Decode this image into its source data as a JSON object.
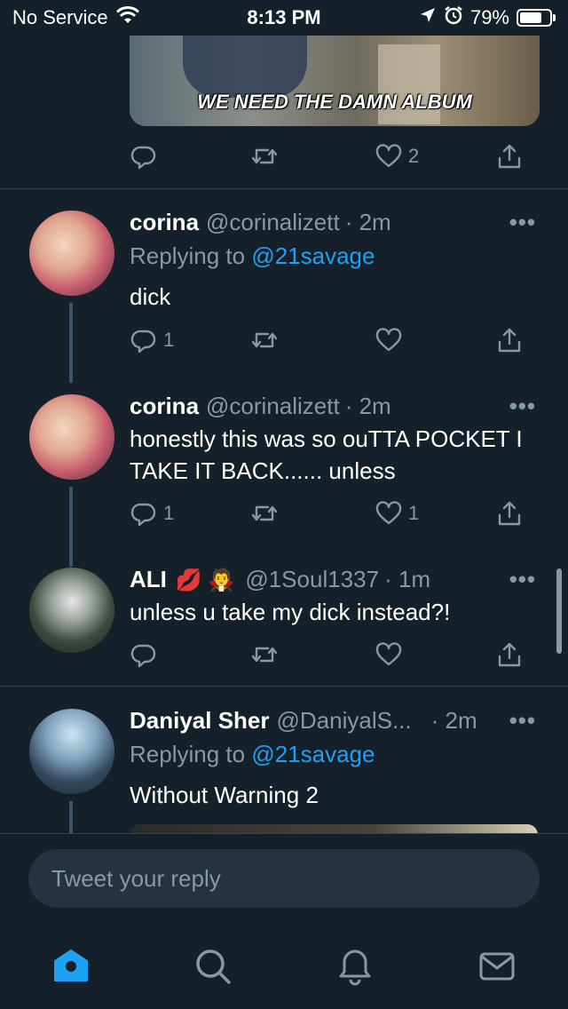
{
  "status_bar": {
    "carrier": "No Service",
    "time": "8:13 PM",
    "battery": "79%",
    "battery_level": 0.79
  },
  "top_tweet": {
    "media_caption": "WE NEED THE DAMN ALBUM",
    "reply_count": "",
    "retweet_count": "",
    "like_count": "2"
  },
  "tweets": [
    {
      "name": "corina",
      "handle": "@corinalizett",
      "time": "· 2m",
      "replying_to_prefix": "Replying to",
      "replying_to": "@21savage",
      "text": "dick",
      "reply_count": "1",
      "retweet_count": "",
      "like_count": ""
    },
    {
      "name": "corina",
      "handle": "@corinalizett",
      "time": "· 2m",
      "text": "honestly this was so ouTTA POCKET I TAKE IT BACK...... unless",
      "reply_count": "1",
      "retweet_count": "",
      "like_count": "1"
    },
    {
      "name": "ALI",
      "emoji": "💋 🧛",
      "handle": "@1Soul1337",
      "time": "· 1m",
      "text": "unless u take my dick instead?!",
      "reply_count": "",
      "retweet_count": "",
      "like_count": ""
    },
    {
      "name": "Daniyal Sher",
      "handle": "@DaniyalS...",
      "time": "· 2m",
      "replying_to_prefix": "Replying to",
      "replying_to": "@21savage",
      "text": "Without Warning 2"
    }
  ],
  "more_glyph": "•••",
  "reply_box": {
    "placeholder": "Tweet your reply"
  },
  "tabbar": {
    "tabs": [
      "home-icon",
      "search-icon",
      "notifications-icon",
      "messages-icon"
    ],
    "accent": "#1da1f2"
  },
  "colors": {
    "background": "#15202b",
    "secondary": "#8899a6",
    "link": "#1da1f2"
  }
}
